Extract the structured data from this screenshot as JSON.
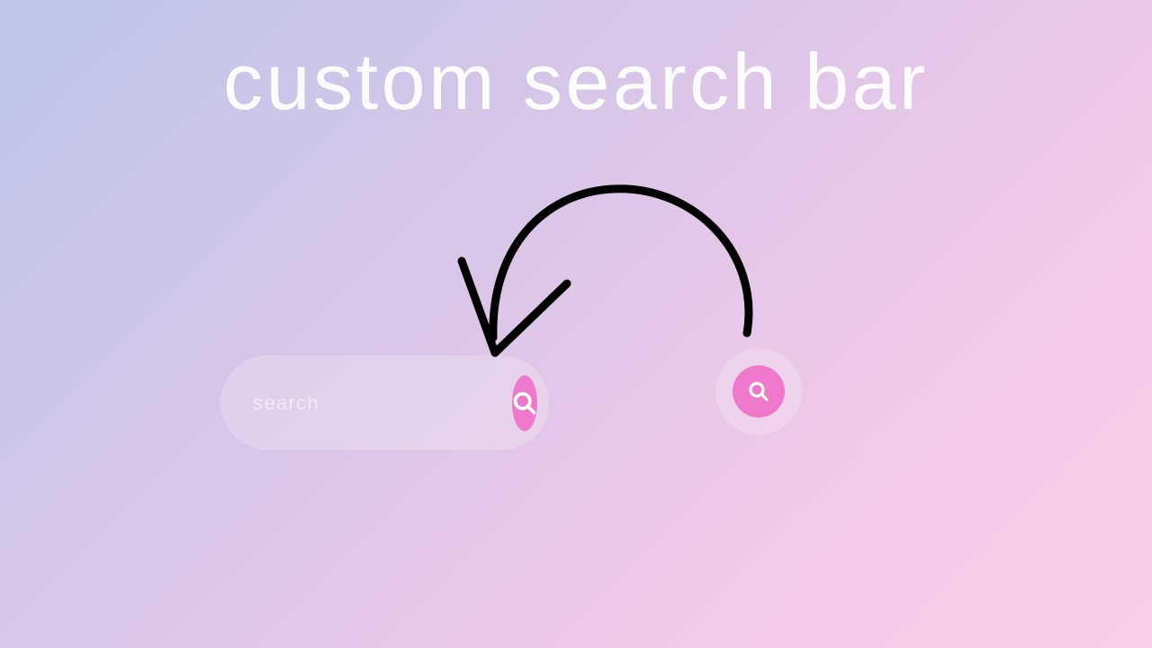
{
  "title": "custom search bar",
  "search": {
    "placeholder": "search",
    "value": ""
  },
  "colors": {
    "accent": "#ee78cc"
  }
}
